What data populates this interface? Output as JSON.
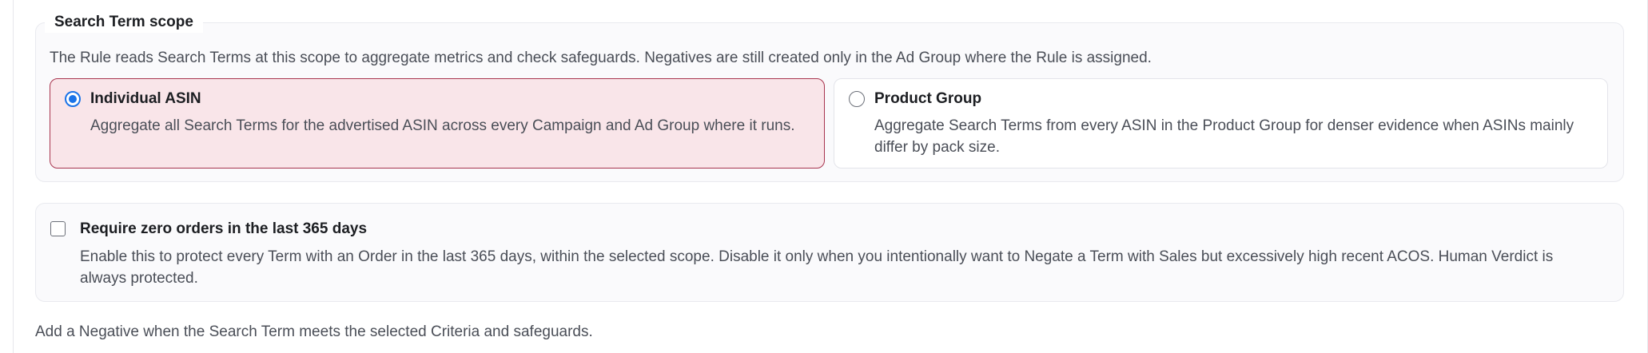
{
  "scope": {
    "legend": "Search Term scope",
    "help": "The Rule reads Search Terms at this scope to aggregate metrics and check safeguards. Negatives are still created only in the Ad Group where the Rule is assigned.",
    "options": [
      {
        "title": "Individual ASIN",
        "description": "Aggregate all Search Terms for the advertised ASIN across every Campaign and Ad Group where it runs.",
        "selected": true
      },
      {
        "title": "Product Group",
        "description": "Aggregate Search Terms from every ASIN in the Product Group for denser evidence when ASINs mainly differ by pack size.",
        "selected": false
      }
    ]
  },
  "orders": {
    "title": "Require zero orders in the last 365 days",
    "description": "Enable this to protect every Term with an Order in the last 365 days, within the selected scope. Disable it only when you intentionally want to Negate a Term with Sales but excessively high recent ACOS. Human Verdict is always protected.",
    "checked": false
  },
  "footer": {
    "note": "Add a Negative when the Search Term meets the selected Criteria and safeguards."
  },
  "colors": {
    "accent": "#1a73e8",
    "selected_border": "#a8354f",
    "selected_bg": "#f9e5e9"
  }
}
